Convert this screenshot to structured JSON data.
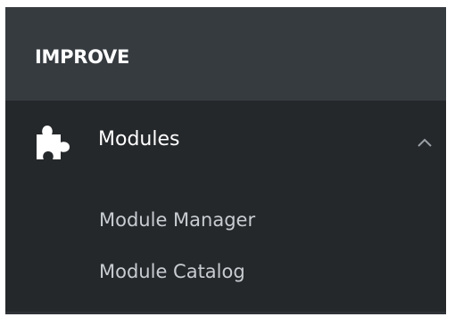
{
  "section": {
    "title": "IMPROVE"
  },
  "menu": {
    "parent": {
      "label": "Modules",
      "icon": "puzzle-icon",
      "expanded": true,
      "toggle_icon": "chevron-up-icon"
    },
    "items": [
      {
        "label": "Module Manager"
      },
      {
        "label": "Module Catalog"
      }
    ]
  },
  "colors": {
    "header_bg": "#363b40",
    "menu_bg": "#25282b",
    "text_primary": "#ffffff",
    "text_secondary": "#c8cdd2"
  }
}
